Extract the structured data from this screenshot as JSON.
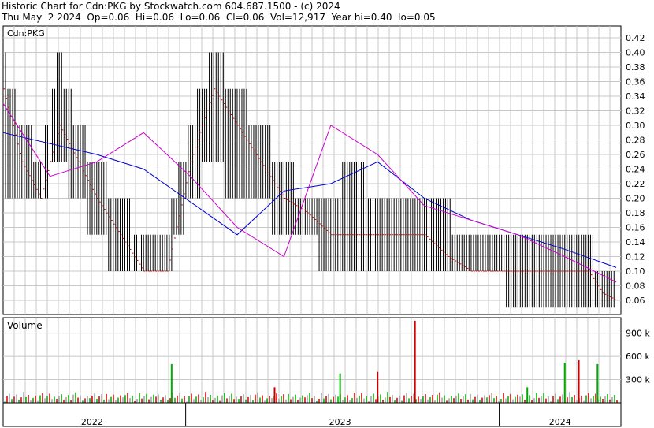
{
  "header": {
    "line1": "Historic Chart for Cdn:PKG by Stockwatch.com 604.687.1500 - (c) 2024",
    "line2": "Thu May  2 2024  Op=0.06  Hi=0.06  Lo=0.06  Cl=0.06  Vol=12,917  Year hi=0.40  lo=0.05"
  },
  "chart_data": [
    {
      "type": "line",
      "title": "Cdn:PKG",
      "ylim": [
        0.04,
        0.43
      ],
      "y_ticks": [
        "0.42",
        "0.40",
        "0.38",
        "0.36",
        "0.34",
        "0.32",
        "0.30",
        "0.28",
        "0.26",
        "0.24",
        "0.22",
        "0.20",
        "0.18",
        "0.16",
        "0.14",
        "0.12",
        "0.10",
        "0.08",
        "0.06"
      ],
      "x_ticks": [
        "2022",
        "2023",
        "2024"
      ],
      "colors": {
        "price": "#000000",
        "close_marks": "#cc0000",
        "ma_short": "#cc00cc",
        "ma_long": "#0000cc",
        "grid": "#c8c8c8"
      },
      "series": [
        {
          "name": "price",
          "x": [
            0,
            0.04,
            0.08,
            0.12,
            0.16,
            0.2,
            0.25,
            0.3,
            0.35,
            0.4,
            0.45,
            0.5,
            0.55,
            0.6,
            0.65,
            0.7,
            0.75,
            0.8,
            0.85,
            0.9,
            0.95,
            1.0,
            1.05,
            1.1,
            1.15,
            1.2,
            1.25,
            1.28,
            1.31
          ],
          "hi": [
            0.4,
            0.3,
            0.26,
            0.4,
            0.3,
            0.25,
            0.2,
            0.15,
            0.15,
            0.3,
            0.4,
            0.35,
            0.3,
            0.25,
            0.2,
            0.2,
            0.25,
            0.2,
            0.2,
            0.18,
            0.18,
            0.15,
            0.15,
            0.15,
            0.15,
            0.15,
            0.15,
            0.1,
            0.08
          ],
          "lo": [
            0.2,
            0.2,
            0.2,
            0.25,
            0.2,
            0.15,
            0.1,
            0.1,
            0.1,
            0.2,
            0.25,
            0.2,
            0.2,
            0.15,
            0.15,
            0.1,
            0.1,
            0.1,
            0.1,
            0.1,
            0.1,
            0.1,
            0.1,
            0.05,
            0.05,
            0.05,
            0.05,
            0.05,
            0.06
          ],
          "close": [
            0.35,
            0.25,
            0.2,
            0.3,
            0.25,
            0.2,
            0.15,
            0.1,
            0.1,
            0.25,
            0.35,
            0.3,
            0.25,
            0.2,
            0.18,
            0.15,
            0.15,
            0.15,
            0.15,
            0.15,
            0.12,
            0.1,
            0.1,
            0.1,
            0.1,
            0.1,
            0.1,
            0.07,
            0.06
          ]
        },
        {
          "name": "ma_short",
          "x": [
            0,
            0.1,
            0.2,
            0.3,
            0.4,
            0.5,
            0.6,
            0.7,
            0.8,
            0.9,
            1.0,
            1.1,
            1.2,
            1.31
          ],
          "values": [
            0.33,
            0.23,
            0.25,
            0.29,
            0.23,
            0.16,
            0.12,
            0.3,
            0.26,
            0.19,
            0.17,
            0.15,
            0.12,
            0.085
          ]
        },
        {
          "name": "ma_long",
          "x": [
            0,
            0.2,
            0.3,
            0.5,
            0.6,
            0.7,
            0.8,
            0.9,
            1.0,
            1.1,
            1.2,
            1.31
          ],
          "values": [
            0.29,
            0.26,
            0.24,
            0.15,
            0.21,
            0.22,
            0.25,
            0.2,
            0.17,
            0.15,
            0.13,
            0.105
          ]
        }
      ]
    },
    {
      "type": "bar",
      "title": "Volume",
      "ylim": [
        0,
        1100000
      ],
      "y_ticks": [
        "900 k",
        "600 k",
        "300 k"
      ],
      "colors": {
        "up": "#00aa00",
        "down": "#cc0000",
        "flat": "#a0a0a0"
      },
      "highlights": [
        {
          "x": 0.36,
          "value": 500000,
          "color": "up"
        },
        {
          "x": 0.58,
          "value": 200000,
          "color": "down"
        },
        {
          "x": 0.72,
          "value": 380000,
          "color": "up"
        },
        {
          "x": 0.8,
          "value": 400000,
          "color": "down"
        },
        {
          "x": 0.88,
          "value": 1060000,
          "color": "down"
        },
        {
          "x": 1.12,
          "value": 200000,
          "color": "up"
        },
        {
          "x": 1.2,
          "value": 520000,
          "color": "up"
        },
        {
          "x": 1.23,
          "value": 550000,
          "color": "down"
        },
        {
          "x": 1.27,
          "value": 500000,
          "color": "up"
        }
      ]
    }
  ]
}
